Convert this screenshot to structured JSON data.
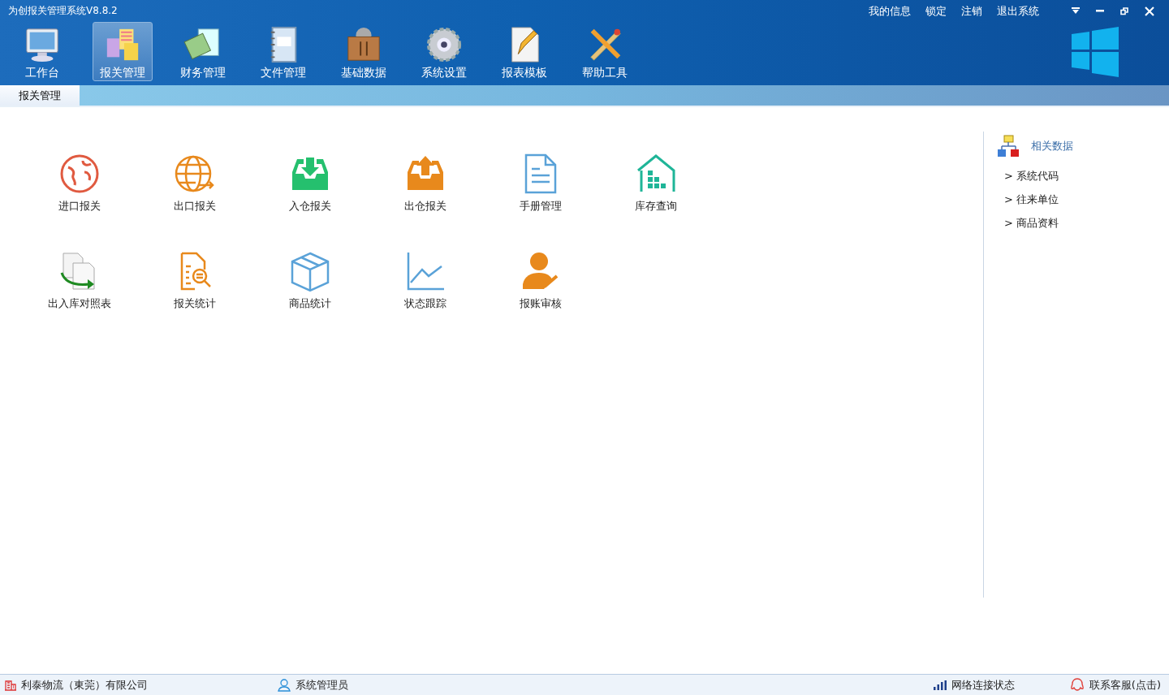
{
  "window": {
    "title": "为创报关管理系统V8.8.2"
  },
  "top_links": [
    "我的信息",
    "锁定",
    "注销",
    "退出系统"
  ],
  "toolbar": [
    {
      "label": "工作台",
      "selected": false
    },
    {
      "label": "报关管理",
      "selected": true
    },
    {
      "label": "财务管理",
      "selected": false
    },
    {
      "label": "文件管理",
      "selected": false
    },
    {
      "label": "基础数据",
      "selected": false
    },
    {
      "label": "系统设置",
      "selected": false
    },
    {
      "label": "报表模板",
      "selected": false
    },
    {
      "label": "帮助工具",
      "selected": false
    }
  ],
  "tabs": [
    {
      "label": "报关管理",
      "selected": true
    }
  ],
  "modules": [
    {
      "label": "进口报关"
    },
    {
      "label": "出口报关"
    },
    {
      "label": "入仓报关"
    },
    {
      "label": "出仓报关"
    },
    {
      "label": "手册管理"
    },
    {
      "label": "库存查询"
    },
    {
      "label": "出入库对照表"
    },
    {
      "label": "报关统计"
    },
    {
      "label": "商品统计"
    },
    {
      "label": "状态跟踪"
    },
    {
      "label": "报账审核"
    }
  ],
  "side_panel": {
    "title": "相关数据",
    "items": [
      "> 系统代码",
      "> 往来单位",
      "> 商品资料"
    ]
  },
  "status_bar": {
    "company": "利泰物流（東莞）有限公司",
    "user": "系统管理员",
    "network": "网络连接状态",
    "support": "联系客服(点击)"
  }
}
